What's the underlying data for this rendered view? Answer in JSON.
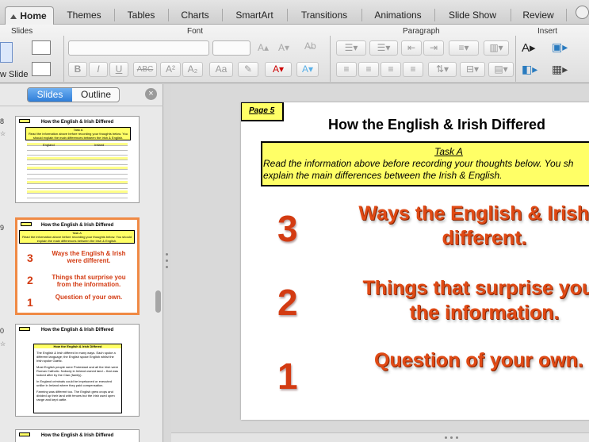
{
  "tabs": [
    {
      "label": "Home",
      "active": true
    },
    {
      "label": "Themes"
    },
    {
      "label": "Tables"
    },
    {
      "label": "Charts"
    },
    {
      "label": "SmartArt"
    },
    {
      "label": "Transitions"
    },
    {
      "label": "Animations"
    },
    {
      "label": "Slide Show"
    },
    {
      "label": "Review"
    }
  ],
  "ribbon": {
    "groups": {
      "slides": "Slides",
      "font": "Font",
      "paragraph": "Paragraph",
      "insert": "Insert"
    },
    "new_slide_label": "w Slide",
    "font_buttons": {
      "bold": "B",
      "italic": "I",
      "underline": "U",
      "strike": "ABC"
    }
  },
  "left_pane": {
    "tabs": {
      "slides": "Slides",
      "outline": "Outline"
    },
    "thumbnails": [
      {
        "number": "8",
        "title": "How the English & Irish Differed",
        "task_heading": "Task A",
        "task_text": "Read the information above before recording your thoughts below. You should explain the main differences between the Irish & English.",
        "col1": "England",
        "col2": "Ireland"
      },
      {
        "number": "9",
        "title": "How the English & Irish Differed",
        "task_heading": "Task A",
        "task_text": "Read the information above before recording your thoughts below. You should explain the main differences between the Irish & English.",
        "items": [
          {
            "num": "3",
            "text": "Ways the English & Irish were different."
          },
          {
            "num": "2",
            "text": "Things that surprise you from the information."
          },
          {
            "num": "1",
            "text": "Question of your own."
          }
        ]
      },
      {
        "number": "0",
        "title": "How the English & Irish Differed",
        "box_title": "How the English & Irish Differed",
        "paragraphs": [
          "The English & Irish differed in many ways. Each spoke a different language; the English spoke English whilst the Irish spoke Gaelic.",
          "Most English people were Protestant and all the Irish were Roman Catholic. Nobody in Ireland owned land – that was looked after by the Clan (family).",
          "In England criminals could be imprisoned or executed unlike in Ireland where they paid compensation.",
          "Farming was different too. The English grew crops and divided up their land with fences but the Irish used open range and kept cattle."
        ]
      },
      {
        "number": "",
        "title": "How the English & Irish Differed"
      }
    ]
  },
  "slide": {
    "page_label": "Page 5",
    "title": "How the English & Irish Differed",
    "task_heading": "Task A",
    "task_line1": "Read the information above before recording your thoughts below. You sh",
    "task_line2": "explain the main differences between the Irish & English.",
    "items": [
      {
        "num": "3",
        "line1": "Ways the English & Irish w",
        "line2": "different."
      },
      {
        "num": "2",
        "line1": "Things that surprise you f",
        "line2": "the information."
      },
      {
        "num": "1",
        "line1": "Question of your own.",
        "line2": ""
      }
    ]
  },
  "colors": {
    "accent_orange": "#d33b12",
    "task_yellow": "#ffff66",
    "selection": "#f08a45",
    "active_tab_blue": "#2f7ed8"
  }
}
